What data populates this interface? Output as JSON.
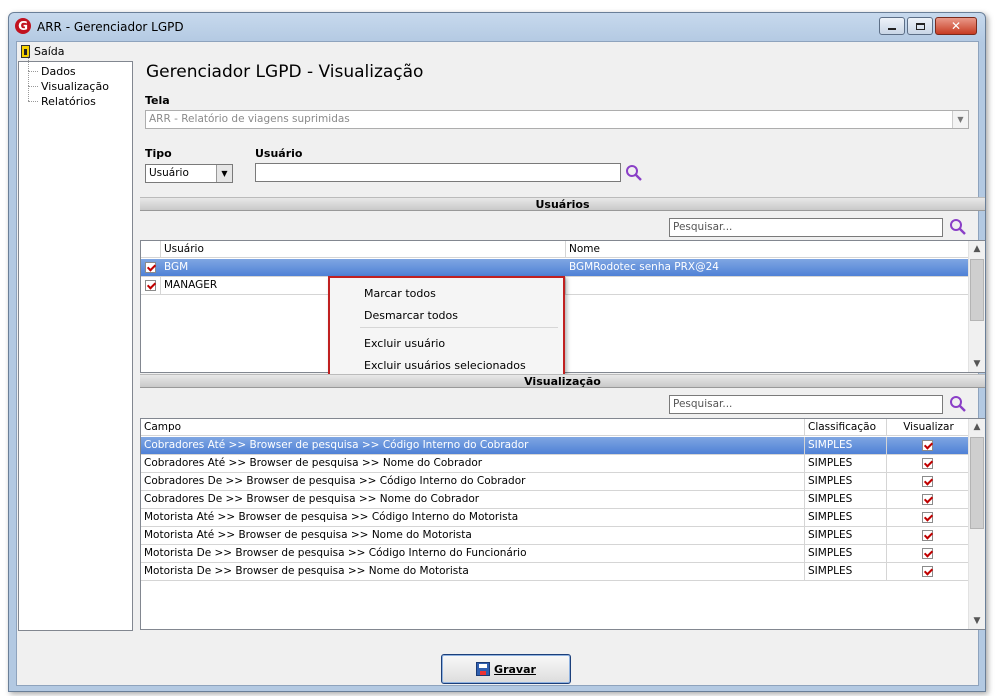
{
  "window": {
    "title": "ARR - Gerenciador LGPD",
    "app_icon": "G",
    "close_glyph": "✕"
  },
  "menu": {
    "exit_label": "Saída"
  },
  "tree": {
    "items": [
      "Dados",
      "Visualização",
      "Relatórios"
    ]
  },
  "page": {
    "title": "Gerenciador LGPD - Visualização"
  },
  "tela": {
    "label": "Tela",
    "value": "ARR - Relatório de viagens suprimidas"
  },
  "tipo": {
    "label": "Tipo",
    "value": "Usuário"
  },
  "usuario": {
    "label": "Usuário",
    "value": ""
  },
  "users_section": {
    "title": "Usuários",
    "search_placeholder": "Pesquisar...",
    "columns": [
      "Usuário",
      "Nome"
    ],
    "rows": [
      {
        "user": "BGM",
        "name": "BGMRodotec senha PRX@24",
        "checked": true,
        "selected": true
      },
      {
        "user": "MANAGER",
        "name": "",
        "checked": true,
        "selected": false
      }
    ]
  },
  "context_menu": {
    "items": [
      "Marcar todos",
      "Desmarcar todos",
      "Excluir usuário",
      "Excluir usuários selecionados"
    ]
  },
  "view_section": {
    "title": "Visualização",
    "search_placeholder": "Pesquisar...",
    "columns": [
      "Campo",
      "Classificação",
      "Visualizar"
    ],
    "rows": [
      {
        "campo": "Cobradores Até >> Browser de pesquisa >> Código Interno do Cobrador",
        "classificacao": "SIMPLES",
        "visualizar": true,
        "selected": true
      },
      {
        "campo": "Cobradores Até >> Browser de pesquisa >> Nome do Cobrador",
        "classificacao": "SIMPLES",
        "visualizar": true
      },
      {
        "campo": "Cobradores De >> Browser de pesquisa >> Código Interno do Cobrador",
        "classificacao": "SIMPLES",
        "visualizar": true
      },
      {
        "campo": "Cobradores De >> Browser de pesquisa >> Nome do Cobrador",
        "classificacao": "SIMPLES",
        "visualizar": true
      },
      {
        "campo": "Motorista Até >> Browser de pesquisa >> Código Interno do Motorista",
        "classificacao": "SIMPLES",
        "visualizar": true
      },
      {
        "campo": "Motorista Até >> Browser de pesquisa >> Nome do Motorista",
        "classificacao": "SIMPLES",
        "visualizar": true
      },
      {
        "campo": "Motorista De >> Browser de pesquisa >> Código Interno do Funcionário",
        "classificacao": "SIMPLES",
        "visualizar": true
      },
      {
        "campo": "Motorista De >> Browser de pesquisa >> Nome do Motorista",
        "classificacao": "SIMPLES",
        "visualizar": true
      }
    ]
  },
  "footer": {
    "save_label": "Gravar"
  },
  "colors": {
    "selection": "#4f81d6",
    "accent_lens": "#8a3fc7",
    "highlight_border": "#c02020"
  }
}
